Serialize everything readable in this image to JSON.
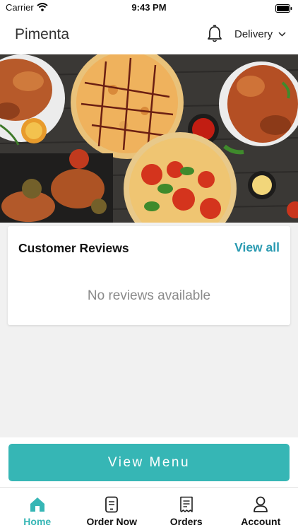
{
  "status_bar": {
    "carrier": "Carrier",
    "time": "9:43 PM"
  },
  "header": {
    "title": "Pimenta",
    "delivery_label": "Delivery"
  },
  "hero": {
    "image": "food-banner"
  },
  "reviews": {
    "title": "Customer Reviews",
    "view_all": "View all",
    "empty_text": "No reviews available"
  },
  "cta": {
    "label": "View Menu"
  },
  "tabbar": {
    "items": [
      {
        "label": "Home",
        "icon": "home-icon",
        "active": true
      },
      {
        "label": "Order Now",
        "icon": "order-now-icon",
        "active": false
      },
      {
        "label": "Orders",
        "icon": "orders-receipt-icon",
        "active": false
      },
      {
        "label": "Account",
        "icon": "account-icon",
        "active": false
      }
    ]
  },
  "colors": {
    "accent": "#36b6b5",
    "link": "#2a9ab1"
  }
}
